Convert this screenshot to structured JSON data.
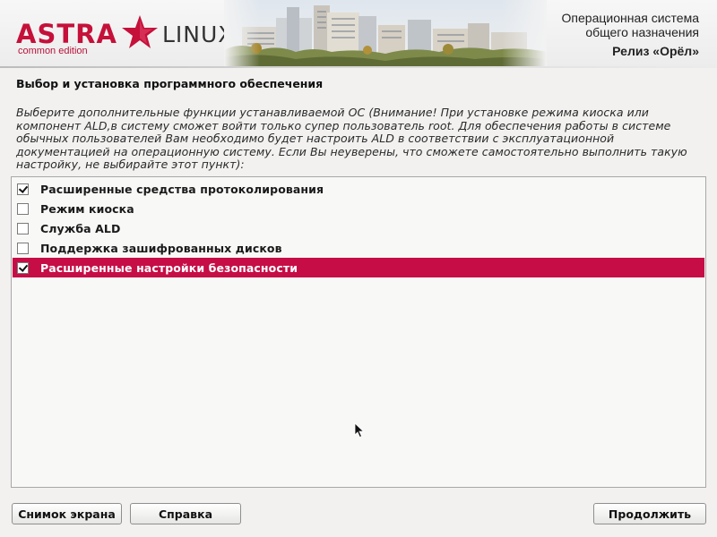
{
  "header": {
    "logo_brand": "ASTRA",
    "logo_product": "LINUX",
    "logo_edition": "common edition",
    "os_line1": "Операционная система",
    "os_line2": "общего назначения",
    "release": "Релиз «Орёл»",
    "accent_color": "#c5103a"
  },
  "main": {
    "title": "Выбор и установка программного обеспечения",
    "description": "Выберите дополнительные функции устанавливаемой ОС (Внимание! При установке режима киоска или компонент ALD,в систему сможет войти только супер пользователь root. Для обеспечения работы в системе обычных пользователей Вам необходимо будет настроить ALD в соответствии с эксплуатационной документацией на операционную систему. Если Вы неуверены, что сможете самостоятельно выполнить такую настройку, не выбирайте этот пункт):",
    "options": [
      {
        "label": "Расширенные средства протоколирования",
        "checked": true,
        "selected": false
      },
      {
        "label": "Режим киоска",
        "checked": false,
        "selected": false
      },
      {
        "label": "Служба ALD",
        "checked": false,
        "selected": false
      },
      {
        "label": "Поддержка зашифрованных дисков",
        "checked": false,
        "selected": false
      },
      {
        "label": "Расширенные настройки безопасности",
        "checked": true,
        "selected": true
      }
    ],
    "selection_color": "#c60d46"
  },
  "footer": {
    "screenshot_label": "Снимок экрана",
    "help_label": "Справка",
    "continue_label": "Продолжить"
  }
}
